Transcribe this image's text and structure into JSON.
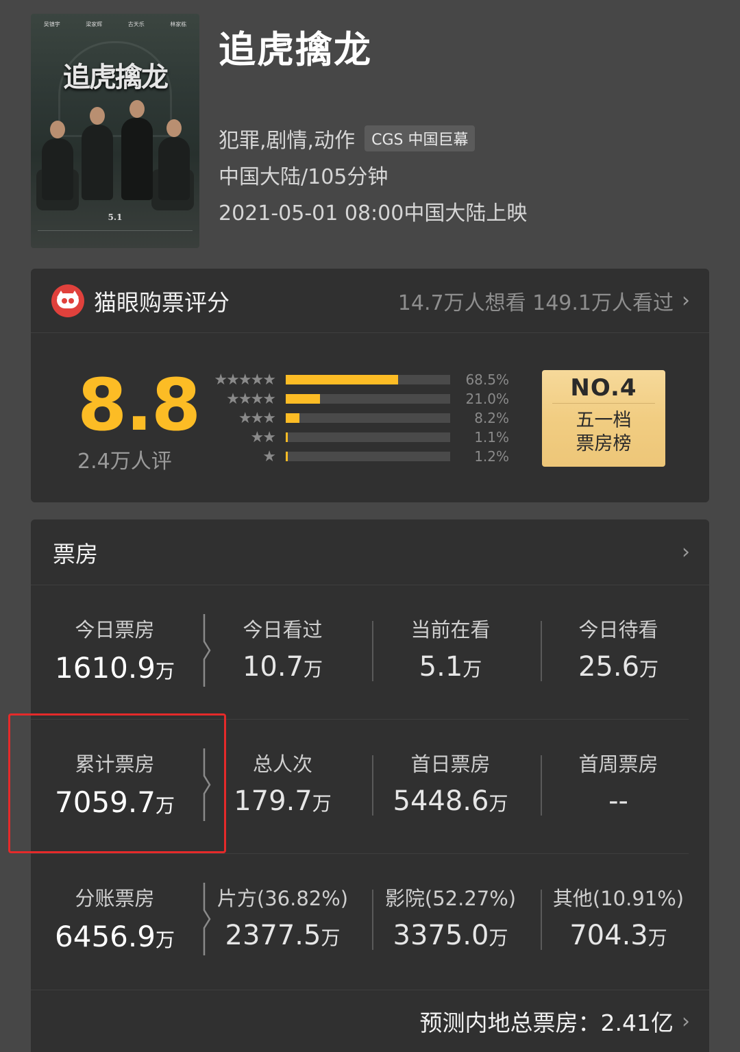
{
  "movie": {
    "title": "追虎擒龙",
    "genre": "犯罪,剧情,动作",
    "format_tag": "CGS 中国巨幕",
    "region_runtime": "中国大陆/105分钟",
    "release": "2021-05-01 08:00中国大陆上映",
    "poster": {
      "title_art": "追虎擒龙",
      "cast": [
        "吴镇宇",
        "梁家辉",
        "古天乐",
        "林家栋"
      ],
      "date": "5.1",
      "icon": "movie-poster-image"
    }
  },
  "rating": {
    "source_label": "猫眼购票评分",
    "audience_text": "14.7万人想看 149.1万人看过",
    "score": "8.8",
    "count": "2.4万人评",
    "distribution": [
      {
        "stars": "★★★★★",
        "pct_label": "68.5%",
        "value": 0.685
      },
      {
        "stars": "★★★★",
        "pct_label": "21.0%",
        "value": 0.21
      },
      {
        "stars": "★★★",
        "pct_label": "8.2%",
        "value": 0.082
      },
      {
        "stars": "★★",
        "pct_label": "1.1%",
        "value": 0.011
      },
      {
        "stars": "★",
        "pct_label": "1.2%",
        "value": 0.012
      }
    ],
    "rank": {
      "no": "NO.4",
      "label_line1": "五一档",
      "label_line2": "票房榜"
    },
    "colors": {
      "score": "#fcbc25",
      "badge": "#f1cd82",
      "logo": "#e0413c"
    }
  },
  "boxoffice": {
    "title": "票房",
    "rows": [
      [
        {
          "label": "今日票房",
          "value": "1610.9",
          "unit": "万"
        },
        {
          "label": "今日看过",
          "value": "10.7",
          "unit": "万"
        },
        {
          "label": "当前在看",
          "value": "5.1",
          "unit": "万"
        },
        {
          "label": "今日待看",
          "value": "25.6",
          "unit": "万"
        }
      ],
      [
        {
          "label": "累计票房",
          "value": "7059.7",
          "unit": "万"
        },
        {
          "label": "总人次",
          "value": "179.7",
          "unit": "万"
        },
        {
          "label": "首日票房",
          "value": "5448.6",
          "unit": "万"
        },
        {
          "label": "首周票房",
          "value": "--",
          "unit": ""
        }
      ],
      [
        {
          "label": "分账票房",
          "value": "6456.9",
          "unit": "万"
        },
        {
          "label": "片方(36.82%)",
          "value": "2377.5",
          "unit": "万"
        },
        {
          "label": "影院(52.27%)",
          "value": "3375.0",
          "unit": "万"
        },
        {
          "label": "其他(10.91%)",
          "value": "704.3",
          "unit": "万"
        }
      ]
    ],
    "forecast": "预测内地总票房：2.41亿",
    "highlight_color": "#e52a2a"
  },
  "icons": {
    "chevron": "›"
  }
}
